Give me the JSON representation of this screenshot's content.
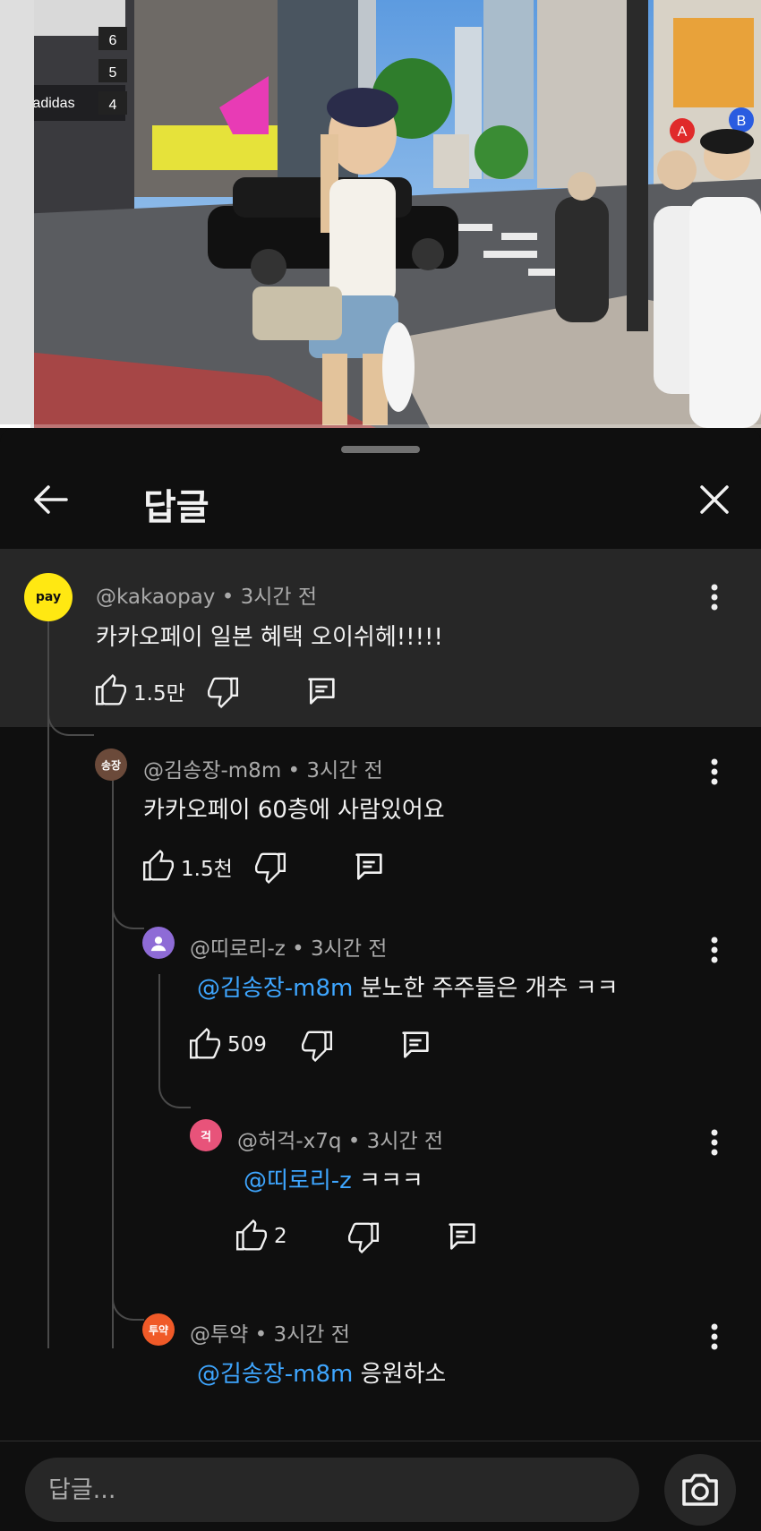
{
  "video": {
    "signs": {
      "floor6": "6",
      "floor5": "5",
      "floor4": "4",
      "brand": "adidas",
      "circle_a": "A",
      "circle_b": "B"
    },
    "progress_fraction": 0.04
  },
  "header": {
    "title": "답글"
  },
  "comments": [
    {
      "avatar_text": "pay",
      "avatar_color": "#ffe812",
      "handle": "@kakaopay • 3시간 전",
      "mention": "",
      "text": "카카오페이 일본 혜택 오이쉬헤!!!!!",
      "likes": "1.5만"
    },
    {
      "avatar_text": "송장",
      "avatar_color": "#6b4a3a",
      "handle": "@김송장-m8m • 3시간 전",
      "mention": "",
      "text": "카카오페이 60층에 사람있어요",
      "likes": "1.5천"
    },
    {
      "avatar_text": "",
      "avatar_color": "#8e6bd6",
      "handle": "@띠로리-z • 3시간 전",
      "mention": "@김송장-m8m",
      "text": " 분노한 주주들은 개추 ㅋㅋ",
      "likes": "509"
    },
    {
      "avatar_text": "걱",
      "avatar_color": "#e8537a",
      "handle": "@허걱-x7q • 3시간 전",
      "mention": "@띠로리-z",
      "text": " ㅋㅋㅋ",
      "likes": "2"
    },
    {
      "avatar_text": "투약",
      "avatar_color": "#f05a28",
      "handle": "@투약 • 3시간 전",
      "mention": "@김송장-m8m",
      "text": " 응원하소",
      "likes": ""
    }
  ],
  "reply_bar": {
    "placeholder": "답글..."
  },
  "icons": {
    "back": "back-arrow-icon",
    "close": "close-icon",
    "like": "thumbs-up-icon",
    "dislike": "thumbs-down-icon",
    "reply": "reply-comment-icon",
    "more": "more-vertical-icon",
    "camera": "camera-icon"
  },
  "colors": {
    "mention": "#3ea6ff",
    "background": "#0f0f0f",
    "highlight": "#272727"
  }
}
